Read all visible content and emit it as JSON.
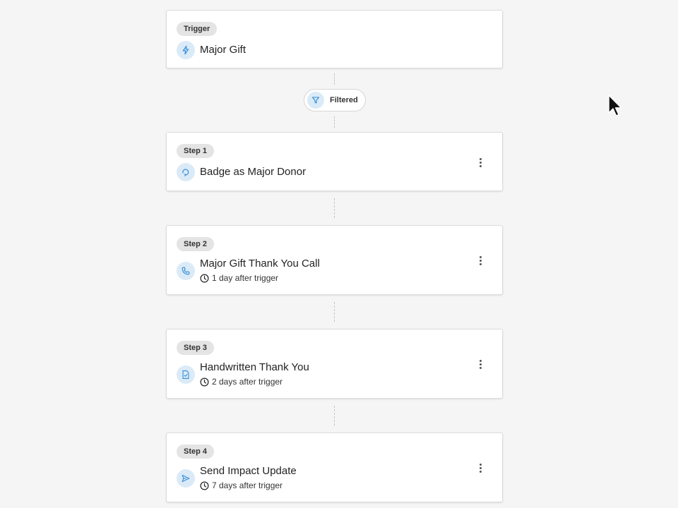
{
  "trigger": {
    "badge": "Trigger",
    "title": "Major Gift",
    "icon": "lightning-icon"
  },
  "filter": {
    "label": "Filtered",
    "icon": "filter-icon"
  },
  "steps": [
    {
      "badge": "Step 1",
      "title": "Badge as Major Donor",
      "delay": "",
      "icon": "badge-icon"
    },
    {
      "badge": "Step 2",
      "title": "Major Gift Thank You Call",
      "delay": "1 day after trigger",
      "icon": "phone-icon"
    },
    {
      "badge": "Step 3",
      "title": "Handwritten Thank You",
      "delay": "2 days after trigger",
      "icon": "note-icon"
    },
    {
      "badge": "Step 4",
      "title": "Send Impact Update",
      "delay": "7 days after trigger",
      "icon": "send-icon"
    }
  ],
  "colors": {
    "accent": "#2b8ad6",
    "icon_bg": "#dbeaf7",
    "badge_bg": "#e4e4e4",
    "page_bg": "#f5f5f5"
  }
}
